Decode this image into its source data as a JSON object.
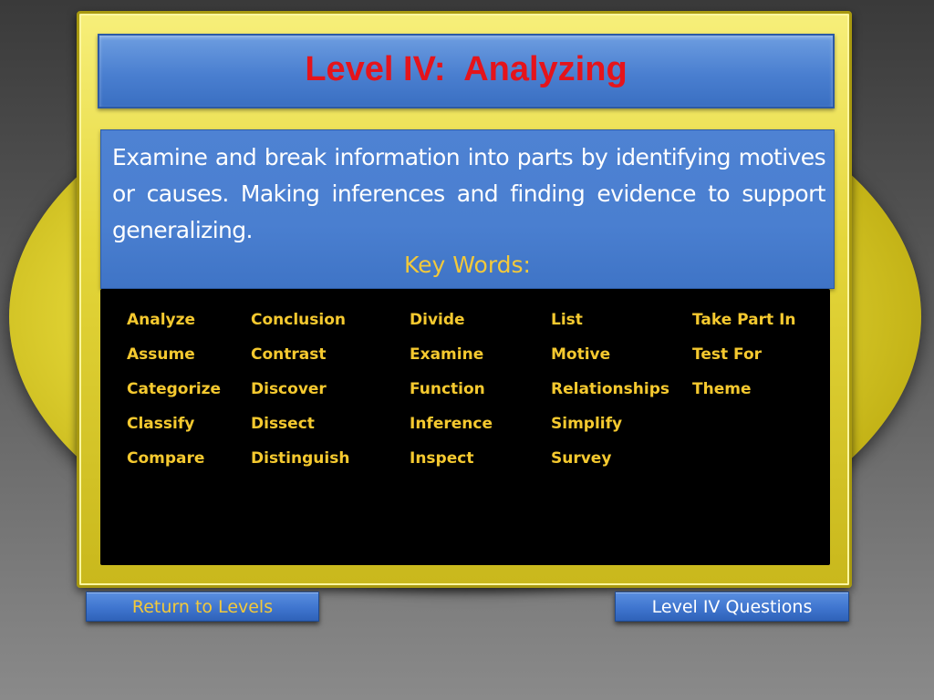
{
  "slide": {
    "title": "Level IV:  Analyzing",
    "description": "Examine and break information into parts by identifying motives or causes.  Making inferences and finding evidence to support  generalizing.",
    "key_words_heading": "Key Words:"
  },
  "key_words": {
    "columns": [
      [
        "Analyze",
        "Assume",
        "Categorize",
        "Classify",
        "Compare"
      ],
      [
        "Conclusion",
        "Contrast",
        "Discover",
        "Dissect",
        "Distinguish"
      ],
      [
        "Divide",
        "Examine",
        "Function",
        "Inference",
        "Inspect"
      ],
      [
        "List",
        "Motive",
        "Relationships",
        "Simplify",
        "Survey"
      ],
      [
        "Take Part In",
        "Test For",
        "Theme"
      ]
    ]
  },
  "buttons": {
    "return_label": "Return to Levels",
    "questions_label": "Level IV Questions"
  },
  "colors": {
    "title_red": "#e5141b",
    "keyword_gold": "#f5c92f",
    "panel_blue": "#4a7fd0",
    "frame_yellow": "#e4d63a"
  }
}
